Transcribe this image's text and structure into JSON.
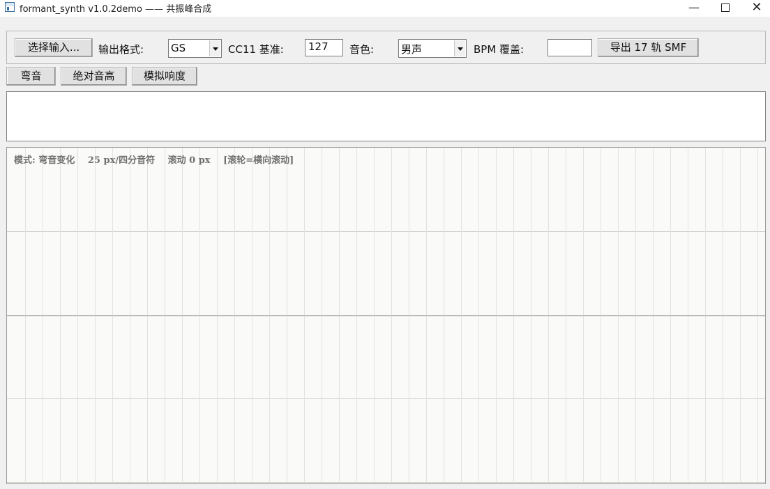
{
  "window": {
    "title": "formant_synth v1.0.2demo —— 共振峰合成",
    "min_glyph": "—",
    "close_glyph": "✕"
  },
  "toolbar": {
    "select_input_label": "选择输入...",
    "output_format_label": "输出格式:",
    "output_format_value": "GS",
    "cc11_label": "CC11 基准:",
    "cc11_value": "127",
    "timbre_label": "音色:",
    "timbre_value": "男声",
    "bpm_label": "BPM 覆盖:",
    "bpm_value": "",
    "export_label": "导出 17 轨 SMF"
  },
  "mode_buttons": {
    "bend_label": "弯音",
    "absolute_pitch_label": "绝对音高",
    "simulate_loudness_label": "模拟响度"
  },
  "log_text": "",
  "canvas": {
    "mode_text": "模式: 弯音变化",
    "scale_text": "25 px/四分音符",
    "scroll_text": "滚动 0 px",
    "hint_text": "[滚轮=横向滚动]"
  }
}
